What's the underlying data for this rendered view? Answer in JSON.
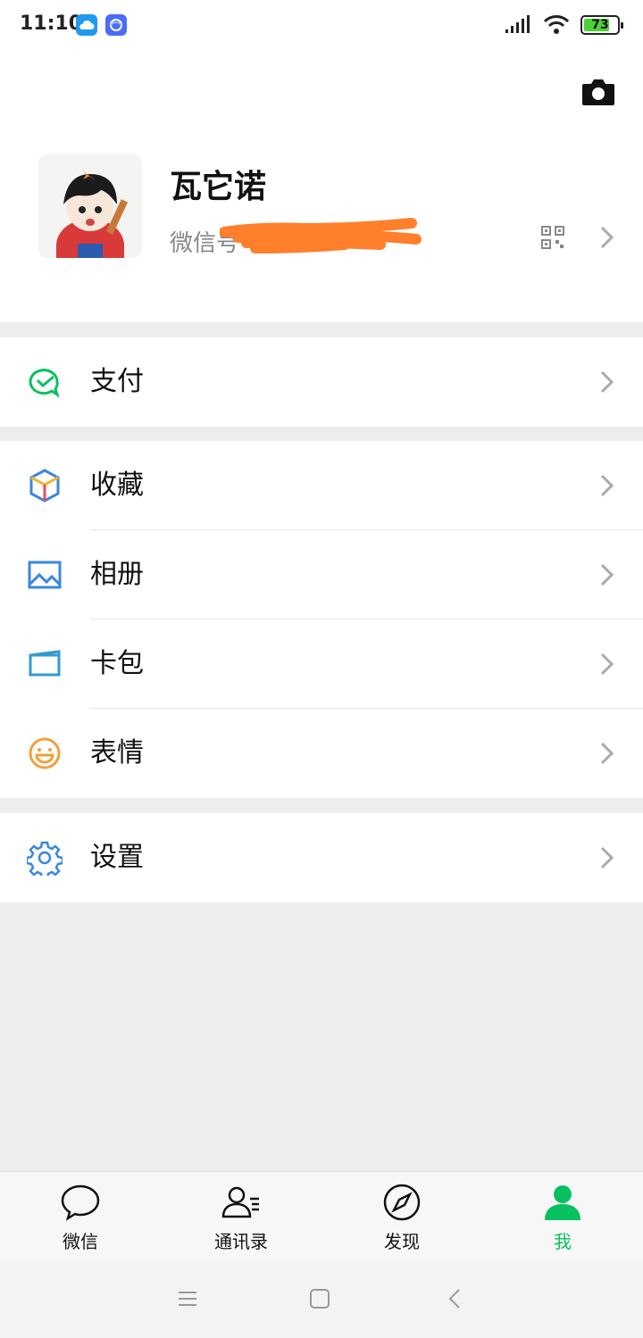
{
  "status_bar": {
    "time": "11:10",
    "battery": "73",
    "icons": [
      "cloud-icon",
      "app-icon",
      "signal-icon",
      "wifi-icon",
      "battery-icon"
    ]
  },
  "profile": {
    "name": "瓦它诺",
    "wechat_id_label": "微信号",
    "icons": [
      "camera-icon",
      "qr-code-icon",
      "chevron-right-icon"
    ]
  },
  "menu": {
    "pay": "支付",
    "favorites": "收藏",
    "album": "相册",
    "cards": "卡包",
    "stickers": "表情",
    "settings": "设置"
  },
  "tabs": {
    "chats": "微信",
    "contacts": "通讯录",
    "discover": "发现",
    "me": "我"
  },
  "colors": {
    "accent_green": "#07c160",
    "background": "#ededed",
    "redaction": "#ff7f2a"
  }
}
